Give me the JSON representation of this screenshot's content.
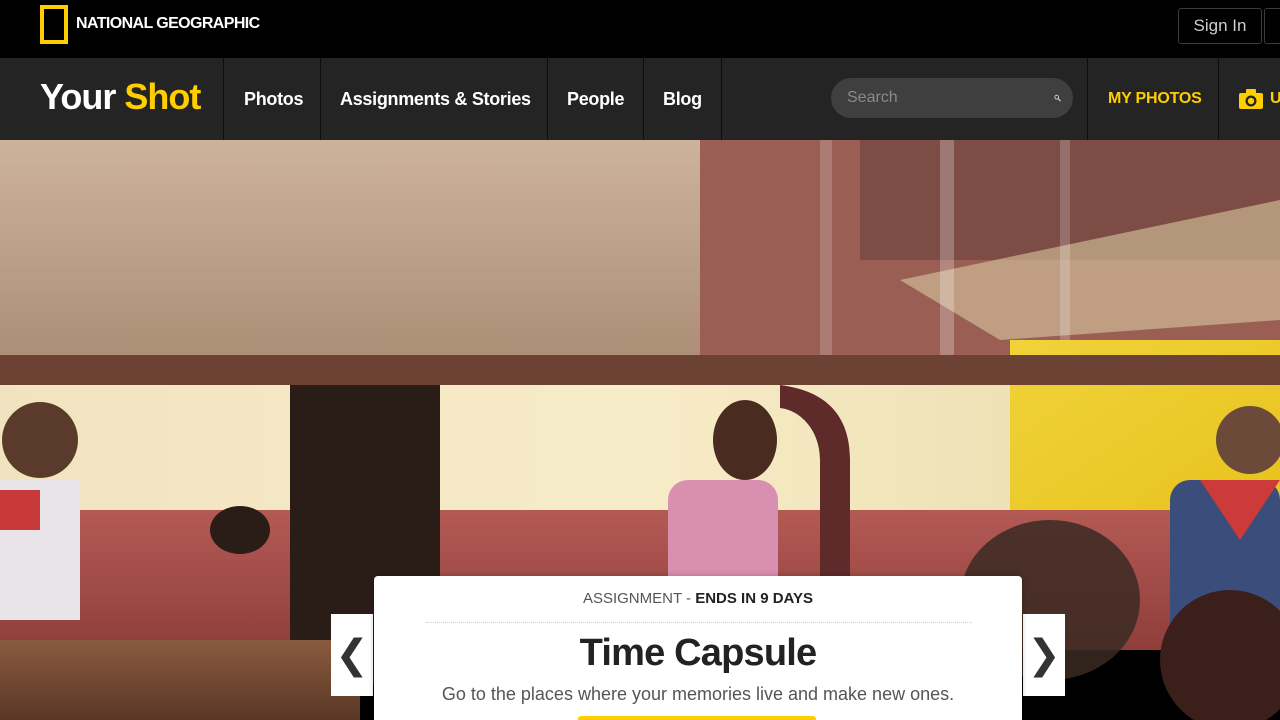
{
  "top_bar": {
    "brand_logo_text": "NATIONAL GEOGRAPHIC",
    "sign_in_label": "Sign In"
  },
  "nav": {
    "brand": {
      "part1": "Your",
      "part2": "Shot"
    },
    "items": [
      {
        "label": "Photos"
      },
      {
        "label": "Assignments & Stories"
      },
      {
        "label": "People"
      },
      {
        "label": "Blog"
      }
    ],
    "search": {
      "placeholder": "Search",
      "value": "",
      "icon": "search-icon"
    },
    "my_photos_label": "MY PHOTOS",
    "upload_label": "U",
    "upload_icon": "camera-icon"
  },
  "hero": {
    "prev_arrow": "❮",
    "next_arrow": "❯",
    "card": {
      "kicker": "ASSIGNMENT",
      "kicker_separator": " - ",
      "ends_label": "ENDS IN 9 DAYS",
      "title": "Time Capsule",
      "description": "Go to the places where your memories live and make new ones."
    }
  },
  "colors": {
    "accent_yellow": "#ffce00",
    "nav_background": "#242424",
    "top_background": "#000000"
  }
}
